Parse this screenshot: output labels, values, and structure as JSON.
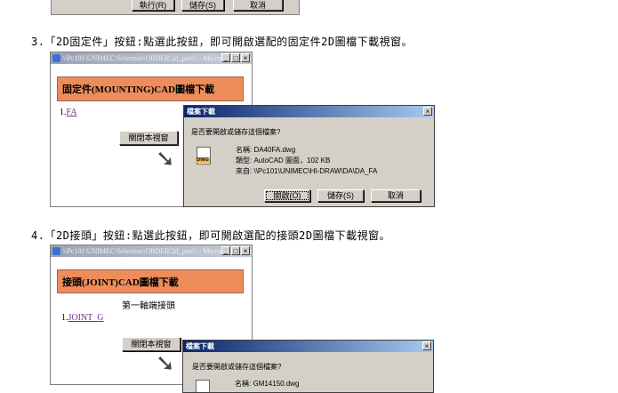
{
  "top_fragment": {
    "buttons": [
      "執行(R)",
      "儲存(S)",
      "取消"
    ]
  },
  "step3": {
    "text": "3.「2D固定件」按鈕:點選此按鈕，即可開啟選配的固定件2D圖檔下載視窗。",
    "browser_title": "\\\\Pc101\\UNIMEC\\Selection\\ORDER\\2d_part\\\\ - Microsoft Internet Explorer",
    "banner": "固定件(MOUNTING)CAD圖檔下載",
    "link_prefix": "1.",
    "link": "FA",
    "close_button": "關閉本視窗",
    "dialog": {
      "title": "檔案下載",
      "question": "是否要開啟或儲存這個檔案?",
      "name_label": "名稱:",
      "name": "DA40FA.dwg",
      "type_label": "類型:",
      "type": "AutoCAD 圖面，102 KB",
      "from_label": "來自:",
      "from": "\\\\Pc101\\UNIMEC\\HI-DRAW\\DA\\DA_FA",
      "file_icon_text": "DWG",
      "buttons": [
        "開啟(O)",
        "儲存(S)",
        "取消"
      ]
    }
  },
  "step4": {
    "text": "4.「2D接頭」按鈕:點選此按鈕，即可開啟選配的接頭2D圖檔下載視窗。",
    "browser_title": "\\\\Pc101\\UNIMEC\\Selection\\ORDER\\2d_part\\\\ - Microsoft Internet Explorer",
    "banner": "接頭(JOINT)CAD圖檔下載",
    "subtitle": "第一軸端接頭",
    "link_prefix": "1.",
    "link": "JOINT_G",
    "close_button": "關閉本視窗",
    "dialog": {
      "title": "檔案下載",
      "question": "是否要開啟或儲存這個檔案?",
      "name_label": "名稱:",
      "name": "GM14150.dwg"
    }
  }
}
